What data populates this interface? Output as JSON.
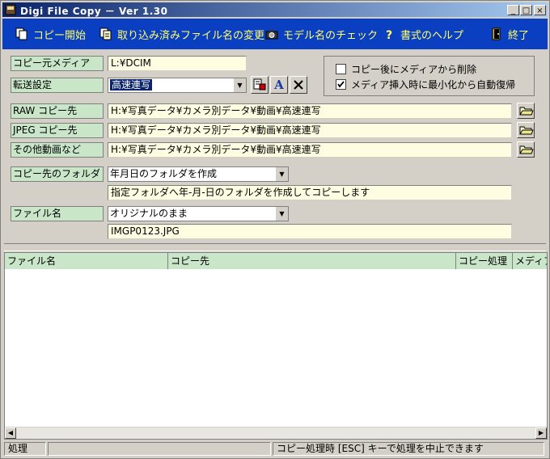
{
  "window": {
    "title": "Digi File Copy  － Ver 1.30",
    "minimize": "_",
    "maximize": "□",
    "close": "×"
  },
  "toolbar": {
    "items": [
      {
        "label": "コピー開始",
        "icon": "copy-icon"
      },
      {
        "label": "取り込み済みファイル名の変更",
        "icon": "rename-icon"
      },
      {
        "label": "モデル名のチェック",
        "icon": "camera-icon"
      },
      {
        "label": "書式のヘルプ",
        "icon": "help-icon"
      },
      {
        "label": "終了",
        "icon": "exit-door-icon"
      }
    ]
  },
  "form": {
    "source_media": {
      "label": "コピー元メディア",
      "value": "L:¥DCIM"
    },
    "transfer": {
      "label": "転送設定",
      "value": "高速連写"
    },
    "raw_dest": {
      "label": "RAW コピー先",
      "value": "H:¥写真データ¥カメラ別データ¥動画¥高速連写"
    },
    "jpeg_dest": {
      "label": "JPEG コピー先",
      "value": "H:¥写真データ¥カメラ別データ¥動画¥高速連写"
    },
    "other_dest": {
      "label": "その他動画など",
      "value": "H:¥写真データ¥カメラ別データ¥動画¥高速連写"
    },
    "dest_folder": {
      "label": "コピー先のフォルダ",
      "value": "年月日のフォルダを作成",
      "description": "指定フォルダへ年-月-日のフォルダを作成してコピーします"
    },
    "file_name": {
      "label": "ファイル名",
      "value": "オリジナルのまま",
      "preview": "IMGP0123.JPG"
    }
  },
  "options": {
    "delete_after_copy": {
      "label": "コピー後にメディアから削除",
      "checked": false
    },
    "auto_restore": {
      "label": "メディア挿入時に最小化から自動復帰",
      "checked": true
    }
  },
  "list": {
    "columns": [
      "ファイル名",
      "コピー先",
      "コピー処理",
      "メディア"
    ]
  },
  "status": {
    "state": "処理",
    "empty": "",
    "hint": "コピー処理時 [ESC] キーで処理を中止できます"
  },
  "colors": {
    "toolbar_bg": "#0b3fc2",
    "toolbar_text": "#ffff66",
    "label_bg": "#c9e6c9",
    "field_bg": "#fffde1"
  }
}
